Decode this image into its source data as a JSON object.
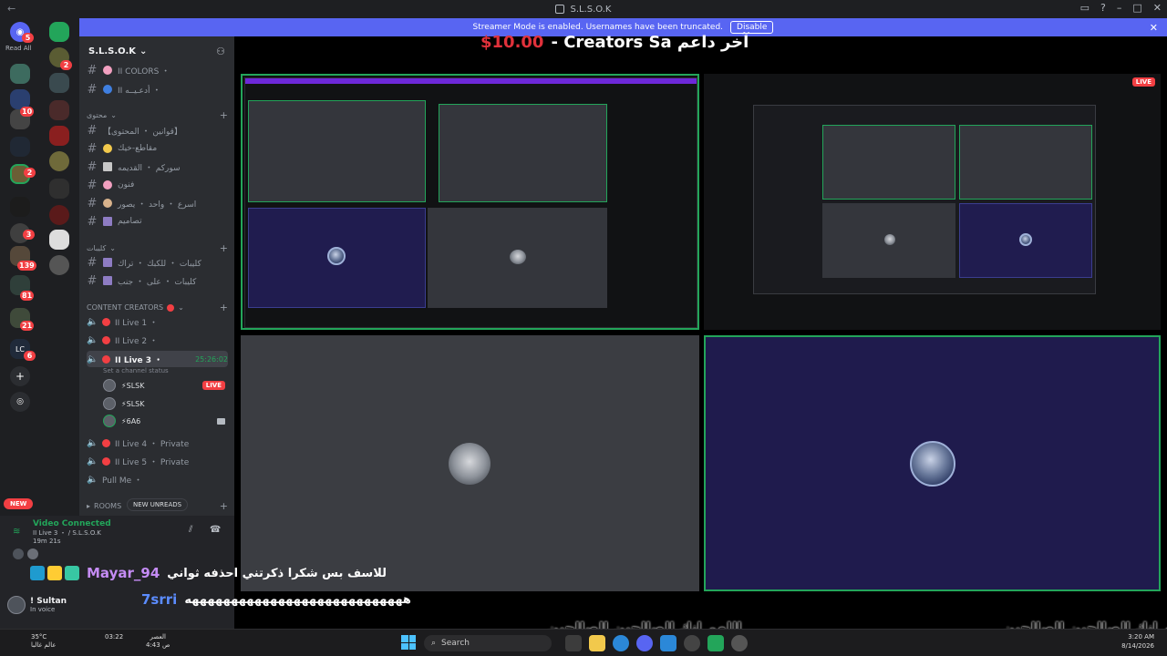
{
  "window": {
    "title": "S.L.S.O.K"
  },
  "banner": {
    "text": "Streamer Mode is enabled. Usernames have been truncated.",
    "disable_label": "Disable"
  },
  "stream_headline": {
    "amount": "$10.00",
    "text": "- Creators Sa آخر داعم"
  },
  "rail": {
    "read_all": "Read All",
    "badges": [
      "5",
      "2",
      "10",
      "2",
      "3",
      "139",
      "81",
      "21",
      "6"
    ]
  },
  "server": {
    "name": "S.L.S.O.K"
  },
  "channels": [
    {
      "name": "II COLORS ・"
    },
    {
      "name": "II أدعـيــه ・"
    },
    {
      "name": "【قوانين ・ المحتوى】"
    },
    {
      "name": "مقاطع-خيك"
    },
    {
      "name": "سوركم ・ القديمه"
    },
    {
      "name": "فنون"
    },
    {
      "name": "اسرع ・ واحد ・ يصور"
    },
    {
      "name": "تصاميم"
    },
    {
      "name": "كليبات ・ للكبك ・ تراك"
    },
    {
      "name": "كليبات ・ على ・ جنب"
    }
  ],
  "categories": {
    "muhtawa": "محتوى",
    "clips": "كليبات",
    "content_creators": "CONTENT CREATORS",
    "rooms": "ROOMS"
  },
  "voice_channels": [
    {
      "name": "II Live 1 ・"
    },
    {
      "name": "II Live 2 ・"
    },
    {
      "name": "II Live 3 ・",
      "timer": "25:26:02",
      "status": "Set a channel status"
    },
    {
      "name": "II Live 4 ・ Private"
    },
    {
      "name": "II Live 5 ・ Private"
    },
    {
      "name": "Pull Me ・"
    }
  ],
  "live3_users": [
    {
      "name": "⚡SLSK",
      "tag": "LIVE"
    },
    {
      "name": "⚡SLSK",
      "tag": ""
    },
    {
      "name": "⚡6A6",
      "tag": ""
    }
  ],
  "pills": {
    "new": "NEW",
    "new_unreads": "NEW UNREADS"
  },
  "voice_connection": {
    "status": "Video Connected",
    "channel": "II Live 3 ・ / S.L.S.O.K",
    "elapsed": "19m 21s"
  },
  "user_panel": {
    "name": "! Sultan",
    "status": "In voice"
  },
  "chat": [
    {
      "user": "Mayar_94",
      "message": "للاسف بس شكرا ذكرتني احذفه ثواني",
      "color": "#c58cf5"
    },
    {
      "user": "7srri",
      "message": "ههههههههههههههههههههههههههههه",
      "color": "#5b8cff"
    }
  ],
  "subtitles": [
    "اللهم انك الصالحين الصالحين",
    "اللهم انك الصالحين الصالحين",
    "اللهم انك الصالحين الصالحين"
  ],
  "taskbar": {
    "temp": "35°C",
    "weather": "عالم غالبا",
    "search": "Search",
    "time": "3:20 AM",
    "date": "8/14/2026",
    "left_time": "03:22",
    "left_label": "العصر",
    "left_time2": "4:43 ص"
  },
  "colors": {
    "accent": "#5865f2",
    "live": "#f23f43",
    "connected": "#23a55a"
  }
}
